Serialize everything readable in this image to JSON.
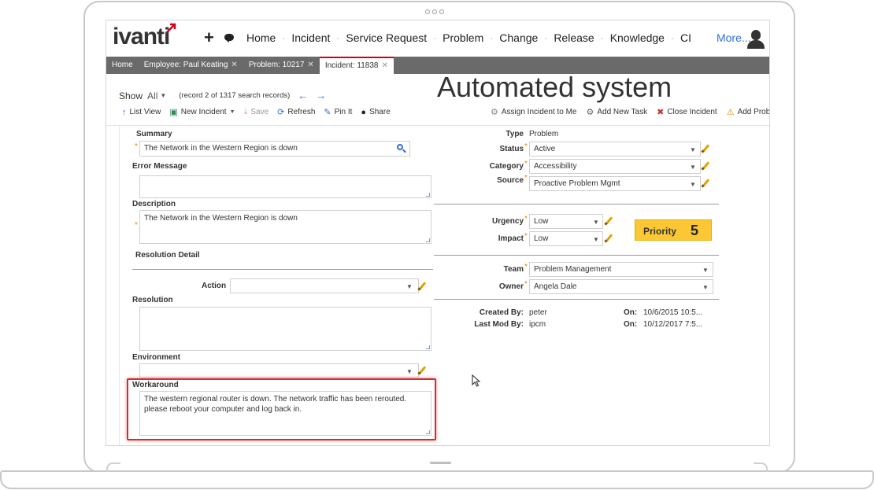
{
  "nav": {
    "logo": "ivanti",
    "items": [
      "Home",
      "Incident",
      "Service Request",
      "Problem",
      "Change",
      "Release",
      "Knowledge",
      "CI"
    ],
    "more": "More..."
  },
  "tabs": [
    {
      "label": "Home",
      "close": false
    },
    {
      "label": "Employee: Paul Keating",
      "close": true
    },
    {
      "label": "Problem: 10217",
      "close": true
    },
    {
      "label": "Incident: 11838",
      "close": true,
      "active": true
    }
  ],
  "show": {
    "label": "Show",
    "value": "All",
    "records": "(record 2 of 1317 search records)"
  },
  "title": "Automated system",
  "toolbar": {
    "list_view": "List View",
    "new_incident": "New Incident",
    "save": "Save",
    "refresh": "Refresh",
    "pin_it": "Pin It",
    "share": "Share",
    "assign_incident": "Assign Incident to Me",
    "add_new_task": "Add New Task",
    "close_incident": "Close Incident",
    "add_problem": "Add Problem"
  },
  "form": {
    "summary_label": "Summary",
    "summary_value": "The Network in the Western Region is down",
    "error_message_label": "Error Message",
    "error_message_value": "",
    "description_label": "Description",
    "description_value": "The Network in the Western Region is down",
    "resolution_detail_label": "Resolution Detail",
    "action_label": "Action",
    "action_value": "",
    "resolution_label": "Resolution",
    "resolution_value": "",
    "environment_label": "Environment",
    "environment_value": "",
    "workaround_label": "Workaround",
    "workaround_value": "The western regional router is down.  The network traffic has been rerouted. please reboot your computer and log back in.",
    "type_label": "Type",
    "type_value": "Problem",
    "status_label": "Status",
    "status_value": "Active",
    "category_label": "Category",
    "category_value": "Accessibility",
    "source_label": "Source",
    "source_value": "Proactive Problem Mgmt",
    "urgency_label": "Urgency",
    "urgency_value": "Low",
    "impact_label": "Impact",
    "impact_value": "Low",
    "priority_label": "Priority",
    "priority_value": "5",
    "team_label": "Team",
    "team_value": "Problem Management",
    "owner_label": "Owner",
    "owner_value": "Angela  Dale",
    "created_by_label": "Created By:",
    "created_by_value": "peter",
    "created_on_label": "On:",
    "created_on_value": "10/6/2015 10:5...",
    "last_mod_label": "Last Mod By:",
    "last_mod_value": "ipcm",
    "last_mod_on_label": "On:",
    "last_mod_on_value": "10/12/2017 7:5..."
  },
  "colors": {
    "accent_blue": "#2f6fd6",
    "tab_active_border": "#d0021b",
    "priority_bg": "#fbc734",
    "highlight_border": "#d32f2f",
    "required_marker": "#e08a00"
  }
}
